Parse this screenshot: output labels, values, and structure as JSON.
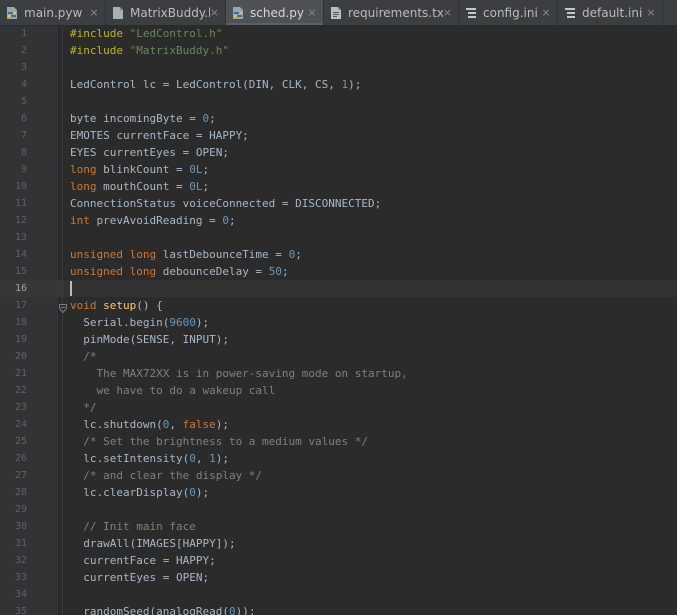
{
  "tabs": [
    {
      "label": "main.pyw",
      "icon": "python-file-icon",
      "active": false
    },
    {
      "label": "MatrixBuddy.h",
      "icon": "header-file-icon",
      "active": false
    },
    {
      "label": "sched.py",
      "icon": "python-file-icon",
      "active": true
    },
    {
      "label": "requirements.txt",
      "icon": "text-file-icon",
      "active": false
    },
    {
      "label": "config.ini",
      "icon": "ini-file-icon",
      "active": false
    },
    {
      "label": "default.ini",
      "icon": "ini-file-icon",
      "active": false
    }
  ],
  "close_glyph": "×",
  "editor": {
    "current_line": 16,
    "lines": [
      {
        "n": "1",
        "tokens": [
          [
            "pp",
            "#include "
          ],
          [
            "str",
            "\"LedControl.h\""
          ]
        ]
      },
      {
        "n": "2",
        "tokens": [
          [
            "pp",
            "#include "
          ],
          [
            "str",
            "\"MatrixBuddy.h\""
          ]
        ]
      },
      {
        "n": "3",
        "tokens": []
      },
      {
        "n": "4",
        "tokens": [
          [
            "pl",
            "LedControl lc = LedControl(DIN, CLK, CS, "
          ],
          [
            "num",
            "1"
          ],
          [
            "pl",
            ");"
          ]
        ]
      },
      {
        "n": "5",
        "tokens": []
      },
      {
        "n": "6",
        "tokens": [
          [
            "pl",
            "byte incomingByte = "
          ],
          [
            "num",
            "0"
          ],
          [
            "pl",
            ";"
          ]
        ]
      },
      {
        "n": "7",
        "tokens": [
          [
            "pl",
            "EMOTES currentFace = HAPPY;"
          ]
        ]
      },
      {
        "n": "8",
        "tokens": [
          [
            "pl",
            "EYES currentEyes = OPEN;"
          ]
        ]
      },
      {
        "n": "9",
        "tokens": [
          [
            "kw",
            "long "
          ],
          [
            "pl",
            "blinkCount = "
          ],
          [
            "num",
            "0L"
          ],
          [
            "pl",
            ";"
          ]
        ]
      },
      {
        "n": "10",
        "tokens": [
          [
            "kw",
            "long "
          ],
          [
            "pl",
            "mouthCount = "
          ],
          [
            "num",
            "0L"
          ],
          [
            "pl",
            ";"
          ]
        ]
      },
      {
        "n": "11",
        "tokens": [
          [
            "pl",
            "ConnectionStatus voiceConnected = DISCONNECTED;"
          ]
        ]
      },
      {
        "n": "12",
        "tokens": [
          [
            "kw",
            "int "
          ],
          [
            "pl",
            "prevAvoidReading = "
          ],
          [
            "num",
            "0"
          ],
          [
            "pl",
            ";"
          ]
        ]
      },
      {
        "n": "13",
        "tokens": []
      },
      {
        "n": "14",
        "tokens": [
          [
            "kw",
            "unsigned long "
          ],
          [
            "pl",
            "lastDebounceTime = "
          ],
          [
            "num",
            "0"
          ],
          [
            "pl",
            ";"
          ]
        ]
      },
      {
        "n": "15",
        "tokens": [
          [
            "kw",
            "unsigned long "
          ],
          [
            "pl",
            "debounceDelay = "
          ],
          [
            "num",
            "50"
          ],
          [
            "pl",
            ";"
          ]
        ]
      },
      {
        "n": "16",
        "tokens": []
      },
      {
        "n": "17",
        "fold": true,
        "tokens": [
          [
            "kw",
            "void "
          ],
          [
            "fn",
            "setup"
          ],
          [
            "pl",
            "() {"
          ]
        ]
      },
      {
        "n": "18",
        "tokens": [
          [
            "pl",
            "  Serial.begin("
          ],
          [
            "num",
            "9600"
          ],
          [
            "pl",
            ");"
          ]
        ]
      },
      {
        "n": "19",
        "tokens": [
          [
            "pl",
            "  pinMode(SENSE, INPUT);"
          ]
        ]
      },
      {
        "n": "20",
        "tokens": [
          [
            "cm",
            "  /*"
          ]
        ]
      },
      {
        "n": "21",
        "tokens": [
          [
            "cm",
            "    The MAX72XX is in power-saving mode on startup,"
          ]
        ]
      },
      {
        "n": "22",
        "tokens": [
          [
            "cm",
            "    we have to do a wakeup call"
          ]
        ]
      },
      {
        "n": "23",
        "tokens": [
          [
            "cm",
            "  */"
          ]
        ]
      },
      {
        "n": "24",
        "tokens": [
          [
            "pl",
            "  lc.shutdown("
          ],
          [
            "num",
            "0"
          ],
          [
            "pl",
            ", "
          ],
          [
            "kw",
            "false"
          ],
          [
            "pl",
            ");"
          ]
        ]
      },
      {
        "n": "25",
        "tokens": [
          [
            "cm",
            "  /* Set the brightness to a medium values */"
          ]
        ]
      },
      {
        "n": "26",
        "tokens": [
          [
            "pl",
            "  lc.setIntensity("
          ],
          [
            "num",
            "0"
          ],
          [
            "pl",
            ", "
          ],
          [
            "num",
            "1"
          ],
          [
            "pl",
            ");"
          ]
        ]
      },
      {
        "n": "27",
        "tokens": [
          [
            "cm",
            "  /* and clear the display */"
          ]
        ]
      },
      {
        "n": "28",
        "tokens": [
          [
            "pl",
            "  lc.clearDisplay("
          ],
          [
            "num",
            "0"
          ],
          [
            "pl",
            ");"
          ]
        ]
      },
      {
        "n": "29",
        "tokens": []
      },
      {
        "n": "30",
        "tokens": [
          [
            "cm",
            "  // Init main face"
          ]
        ]
      },
      {
        "n": "31",
        "tokens": [
          [
            "pl",
            "  drawAll(IMAGES[HAPPY]);"
          ]
        ]
      },
      {
        "n": "32",
        "tokens": [
          [
            "pl",
            "  currentFace = HAPPY;"
          ]
        ]
      },
      {
        "n": "33",
        "tokens": [
          [
            "pl",
            "  currentEyes = OPEN;"
          ]
        ]
      },
      {
        "n": "34",
        "tokens": []
      },
      {
        "n": "35",
        "tokens": [
          [
            "pl",
            "  randomSeed(analogRead("
          ],
          [
            "num",
            "0"
          ],
          [
            "pl",
            "));"
          ]
        ]
      }
    ]
  },
  "colors": {
    "background": "#2b2b2b",
    "tabbar": "#3c3f41",
    "keyword": "#cc7832",
    "preprocessor": "#bbb529",
    "string": "#6a8759",
    "number": "#6897bb",
    "comment": "#808080",
    "plain": "#a9b7c6"
  }
}
